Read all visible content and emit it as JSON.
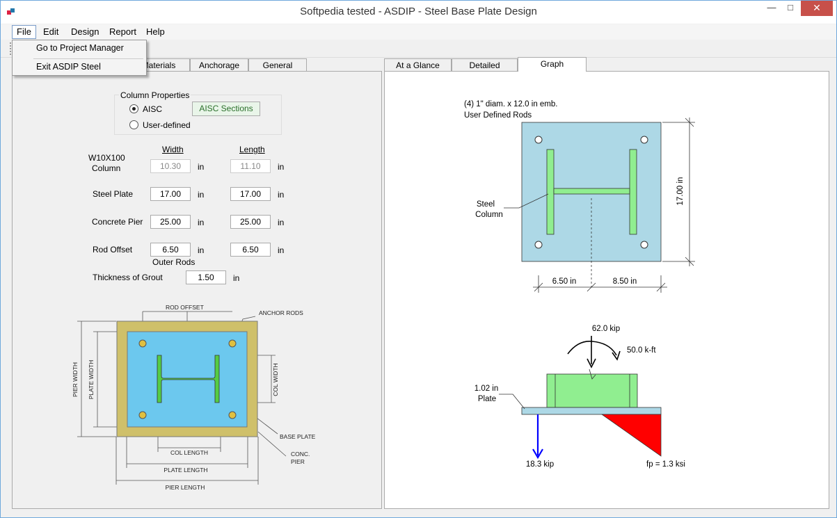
{
  "window": {
    "title": "Softpedia tested - ASDIP - Steel Base Plate Design",
    "min": "—",
    "max": "□",
    "close": "✕"
  },
  "menu": {
    "file": "File",
    "edit": "Edit",
    "design": "Design",
    "report": "Report",
    "help": "Help"
  },
  "file_menu": {
    "project_manager": "Go to Project Manager",
    "exit": "Exit ASDIP Steel"
  },
  "left_tabs": [
    "Materials",
    "Anchorage",
    "General"
  ],
  "right_tabs": [
    "At a Glance",
    "Detailed",
    "Graph"
  ],
  "column_properties": {
    "title": "Column Properties",
    "aisc": "AISC",
    "user_defined": "User-defined",
    "aisc_sections_button": "AISC Sections",
    "selected": "AISC"
  },
  "dims": {
    "width_header": "Width",
    "length_header": "Length",
    "column_section": "W10X100",
    "column_label": "Column",
    "column_width": "10.30",
    "column_length": "11.10",
    "steel_plate_label": "Steel Plate",
    "plate_width": "17.00",
    "plate_length": "17.00",
    "concrete_pier_label": "Concrete Pier",
    "pier_width": "25.00",
    "pier_length": "25.00",
    "rod_offset_label": "Rod Offset",
    "rod_offset_width": "6.50",
    "rod_offset_length": "6.50",
    "outer_rods": "Outer Rods",
    "grout_label": "Thickness of Grout",
    "grout_value": "1.50",
    "unit": "in"
  },
  "sketch": {
    "rod_offset": "ROD OFFSET",
    "anchor_rods": "ANCHOR RODS",
    "pier_width": "PIER WIDTH",
    "plate_width": "PLATE WIDTH",
    "col_width": "COL WIDTH",
    "base_plate": "BASE PLATE",
    "col_length": "COL LENGTH",
    "conc": "CONC.",
    "pier": "PIER",
    "plate_length": "PLATE LENGTH",
    "pier_length": "PIER LENGTH"
  },
  "graph": {
    "rods_line1": "(4) 1\" diam. x 12.0 in emb.",
    "rods_line2": "User Defined Rods",
    "steel": "Steel",
    "column": "Column",
    "plate_height": "17.00 in",
    "left_dim": "6.50 in",
    "right_dim": "8.50 in",
    "axial_load": "62.0 kip",
    "moment": "50.0 k-ft",
    "plate_thk": "1.02 in",
    "plate": "Plate",
    "tension": "18.3 kip",
    "bearing": "fp = 1.3 ksi"
  },
  "colors": {
    "plate_fill": "#add8e6",
    "column_fill": "#90ee90",
    "pier_fill": "#cfc06a",
    "sketch_plate": "#6cc8ee",
    "bearing_red": "#ff0000",
    "tension_blue": "#0000ff"
  }
}
